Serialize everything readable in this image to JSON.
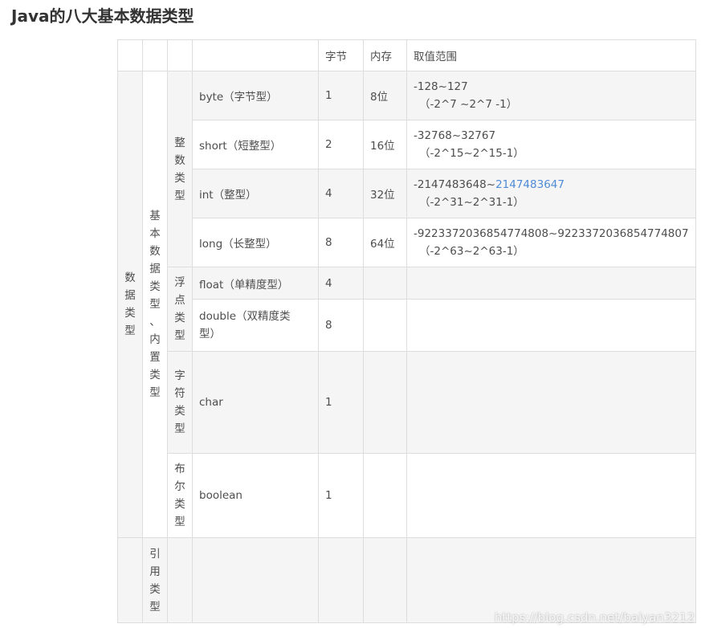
{
  "title": "Java的八大基本数据类型",
  "header": {
    "bytes": "字节",
    "memory": "内存",
    "range": "取值范围"
  },
  "groups": {
    "data_type": "数据类型",
    "primitive": "基本数据类型、内置类型",
    "reference": "引用类型",
    "integer": "整数类型",
    "float": "浮点类型",
    "char": "字符类型",
    "boolean": "布尔类型"
  },
  "rows": {
    "byte": {
      "name": "byte（字节型）",
      "bytes": "1",
      "memory": "8位",
      "range": "-128~127",
      "range2": "（-2^7 ~2^7 -1）"
    },
    "short": {
      "name": "short（短整型）",
      "bytes": "2",
      "memory": "16位",
      "range": "-32768~32767",
      "range2": "（-2^15~2^15-1）"
    },
    "int": {
      "name": "int（整型）",
      "bytes": "4",
      "memory": "32位",
      "range_prefix": "-2147483648~",
      "range_link": "2147483647",
      "range2": "（-2^31~2^31-1）"
    },
    "long": {
      "name": "long（长整型）",
      "bytes": "8",
      "memory": "64位",
      "range": "-9223372036854774808~9223372036854774807",
      "range2": "（-2^63~2^63-1）"
    },
    "float": {
      "name": "float（单精度型）",
      "bytes": "4"
    },
    "double": {
      "name": "double（双精度类型）",
      "bytes": "8"
    },
    "char": {
      "name": "char",
      "bytes": "1"
    },
    "boolean": {
      "name": "boolean",
      "bytes": "1"
    }
  },
  "watermark": "https://blog.csdn.net/baiyan3212"
}
